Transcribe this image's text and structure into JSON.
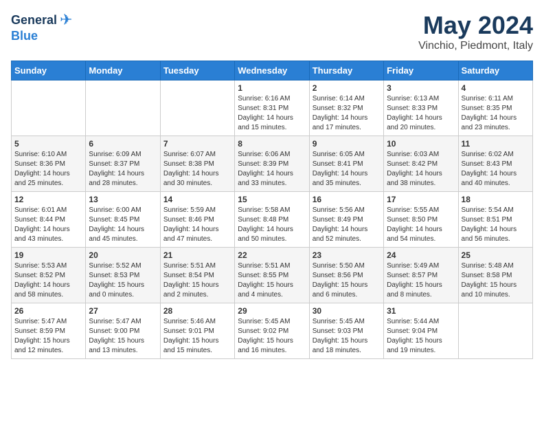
{
  "logo": {
    "general": "General",
    "blue": "Blue"
  },
  "title": "May 2024",
  "location": "Vinchio, Piedmont, Italy",
  "days_of_week": [
    "Sunday",
    "Monday",
    "Tuesday",
    "Wednesday",
    "Thursday",
    "Friday",
    "Saturday"
  ],
  "weeks": [
    [
      {
        "day": "",
        "info": ""
      },
      {
        "day": "",
        "info": ""
      },
      {
        "day": "",
        "info": ""
      },
      {
        "day": "1",
        "info": "Sunrise: 6:16 AM\nSunset: 8:31 PM\nDaylight: 14 hours\nand 15 minutes."
      },
      {
        "day": "2",
        "info": "Sunrise: 6:14 AM\nSunset: 8:32 PM\nDaylight: 14 hours\nand 17 minutes."
      },
      {
        "day": "3",
        "info": "Sunrise: 6:13 AM\nSunset: 8:33 PM\nDaylight: 14 hours\nand 20 minutes."
      },
      {
        "day": "4",
        "info": "Sunrise: 6:11 AM\nSunset: 8:35 PM\nDaylight: 14 hours\nand 23 minutes."
      }
    ],
    [
      {
        "day": "5",
        "info": "Sunrise: 6:10 AM\nSunset: 8:36 PM\nDaylight: 14 hours\nand 25 minutes."
      },
      {
        "day": "6",
        "info": "Sunrise: 6:09 AM\nSunset: 8:37 PM\nDaylight: 14 hours\nand 28 minutes."
      },
      {
        "day": "7",
        "info": "Sunrise: 6:07 AM\nSunset: 8:38 PM\nDaylight: 14 hours\nand 30 minutes."
      },
      {
        "day": "8",
        "info": "Sunrise: 6:06 AM\nSunset: 8:39 PM\nDaylight: 14 hours\nand 33 minutes."
      },
      {
        "day": "9",
        "info": "Sunrise: 6:05 AM\nSunset: 8:41 PM\nDaylight: 14 hours\nand 35 minutes."
      },
      {
        "day": "10",
        "info": "Sunrise: 6:03 AM\nSunset: 8:42 PM\nDaylight: 14 hours\nand 38 minutes."
      },
      {
        "day": "11",
        "info": "Sunrise: 6:02 AM\nSunset: 8:43 PM\nDaylight: 14 hours\nand 40 minutes."
      }
    ],
    [
      {
        "day": "12",
        "info": "Sunrise: 6:01 AM\nSunset: 8:44 PM\nDaylight: 14 hours\nand 43 minutes."
      },
      {
        "day": "13",
        "info": "Sunrise: 6:00 AM\nSunset: 8:45 PM\nDaylight: 14 hours\nand 45 minutes."
      },
      {
        "day": "14",
        "info": "Sunrise: 5:59 AM\nSunset: 8:46 PM\nDaylight: 14 hours\nand 47 minutes."
      },
      {
        "day": "15",
        "info": "Sunrise: 5:58 AM\nSunset: 8:48 PM\nDaylight: 14 hours\nand 50 minutes."
      },
      {
        "day": "16",
        "info": "Sunrise: 5:56 AM\nSunset: 8:49 PM\nDaylight: 14 hours\nand 52 minutes."
      },
      {
        "day": "17",
        "info": "Sunrise: 5:55 AM\nSunset: 8:50 PM\nDaylight: 14 hours\nand 54 minutes."
      },
      {
        "day": "18",
        "info": "Sunrise: 5:54 AM\nSunset: 8:51 PM\nDaylight: 14 hours\nand 56 minutes."
      }
    ],
    [
      {
        "day": "19",
        "info": "Sunrise: 5:53 AM\nSunset: 8:52 PM\nDaylight: 14 hours\nand 58 minutes."
      },
      {
        "day": "20",
        "info": "Sunrise: 5:52 AM\nSunset: 8:53 PM\nDaylight: 15 hours\nand 0 minutes."
      },
      {
        "day": "21",
        "info": "Sunrise: 5:51 AM\nSunset: 8:54 PM\nDaylight: 15 hours\nand 2 minutes."
      },
      {
        "day": "22",
        "info": "Sunrise: 5:51 AM\nSunset: 8:55 PM\nDaylight: 15 hours\nand 4 minutes."
      },
      {
        "day": "23",
        "info": "Sunrise: 5:50 AM\nSunset: 8:56 PM\nDaylight: 15 hours\nand 6 minutes."
      },
      {
        "day": "24",
        "info": "Sunrise: 5:49 AM\nSunset: 8:57 PM\nDaylight: 15 hours\nand 8 minutes."
      },
      {
        "day": "25",
        "info": "Sunrise: 5:48 AM\nSunset: 8:58 PM\nDaylight: 15 hours\nand 10 minutes."
      }
    ],
    [
      {
        "day": "26",
        "info": "Sunrise: 5:47 AM\nSunset: 8:59 PM\nDaylight: 15 hours\nand 12 minutes."
      },
      {
        "day": "27",
        "info": "Sunrise: 5:47 AM\nSunset: 9:00 PM\nDaylight: 15 hours\nand 13 minutes."
      },
      {
        "day": "28",
        "info": "Sunrise: 5:46 AM\nSunset: 9:01 PM\nDaylight: 15 hours\nand 15 minutes."
      },
      {
        "day": "29",
        "info": "Sunrise: 5:45 AM\nSunset: 9:02 PM\nDaylight: 15 hours\nand 16 minutes."
      },
      {
        "day": "30",
        "info": "Sunrise: 5:45 AM\nSunset: 9:03 PM\nDaylight: 15 hours\nand 18 minutes."
      },
      {
        "day": "31",
        "info": "Sunrise: 5:44 AM\nSunset: 9:04 PM\nDaylight: 15 hours\nand 19 minutes."
      },
      {
        "day": "",
        "info": ""
      }
    ]
  ]
}
